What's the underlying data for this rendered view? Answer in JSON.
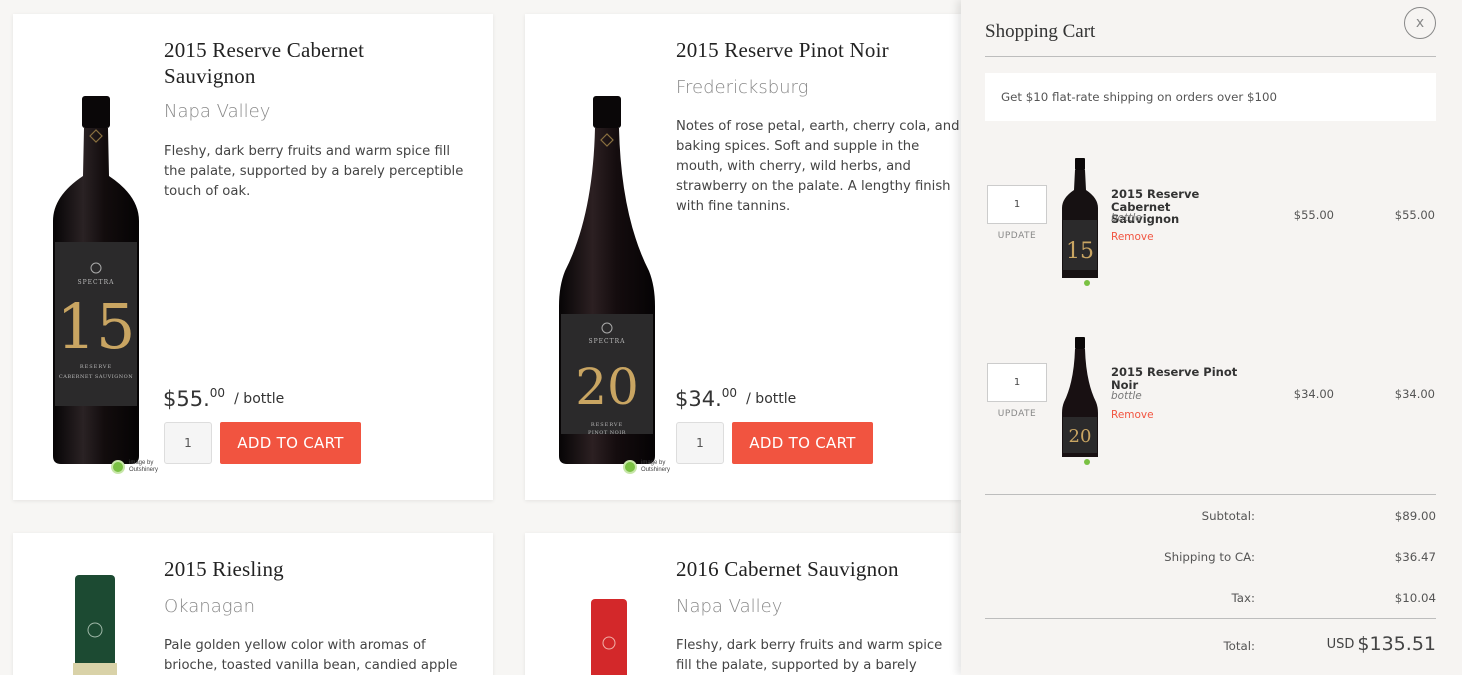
{
  "products": [
    {
      "title": "2015 Reserve Cabernet Sauvignon",
      "title_line1": "2015 Reserve Cabernet",
      "title_line2": "Sauvignon",
      "region": "Napa Valley",
      "description": "Fleshy, dark berry fruits and warm spice fill the palate, supported by a barely perceptible touch of oak.",
      "price_dollars": "$55.",
      "price_cents": "00",
      "price_unit": "/ bottle",
      "quantity": "1",
      "add_label": "ADD TO CART",
      "label_number": "15",
      "label_brand": "SPECTRA",
      "label_sub": "RESERVE",
      "label_varietal": "CABERNET SAUVIGNON",
      "credit": "image by Outshinery",
      "bottle_color": "#1a1416"
    },
    {
      "title": "2015 Reserve Pinot Noir",
      "region": "Fredericksburg",
      "description": "Notes of rose petal, earth, cherry cola, and baking spices. Soft and supple in the mouth, with cherry, wild herbs, and strawberry on the palate. A lengthy finish with fine tannins.",
      "price_dollars": "$34.",
      "price_cents": "00",
      "price_unit": "/ bottle",
      "quantity": "1",
      "add_label": "ADD TO CART",
      "label_number": "20",
      "label_brand": "SPECTRA",
      "label_sub": "RESERVE",
      "label_varietal": "PINOT NOIR",
      "credit": "image by Outshinery",
      "bottle_color": "#1e1416"
    },
    {
      "title": "2015 Riesling",
      "region": "Okanagan",
      "description": "Pale golden yellow color with aromas of brioche, toasted vanilla bean, candied apple",
      "bottle_color": "#1c4a32"
    },
    {
      "title": "2016 Cabernet Sauvignon",
      "region": "Napa Valley",
      "description": "Fleshy, dark berry fruits and warm spice fill the palate, supported by a barely perceptible",
      "bottle_color": "#d3282a"
    }
  ],
  "cart": {
    "title": "Shopping Cart",
    "close_label": "x",
    "shipping_banner": "Get $10 flat-rate shipping on orders over $100",
    "items": [
      {
        "quantity": "1",
        "update_label": "UPDATE",
        "name": "2015 Reserve Cabernet Sauvignon",
        "name_line1": "2015 Reserve",
        "name_line2": "Cabernet Sauvignon",
        "unit": "bottle",
        "remove_label": "Remove",
        "price": "$55.00",
        "line_total": "$55.00"
      },
      {
        "quantity": "1",
        "update_label": "UPDATE",
        "name_line1": "2015 Reserve Pinot",
        "name_line2": "Noir",
        "unit": "bottle",
        "remove_label": "Remove",
        "price": "$34.00",
        "line_total": "$34.00"
      }
    ],
    "subtotal_label": "Subtotal:",
    "subtotal": "$89.00",
    "shipping_label": "Shipping to CA:",
    "shipping": "$36.47",
    "tax_label": "Tax:",
    "tax": "$10.04",
    "total_label": "Total:",
    "currency": "USD",
    "total": "$135.51"
  },
  "colors": {
    "accent": "#f15440",
    "panel_bg": "#f6f4f2"
  }
}
